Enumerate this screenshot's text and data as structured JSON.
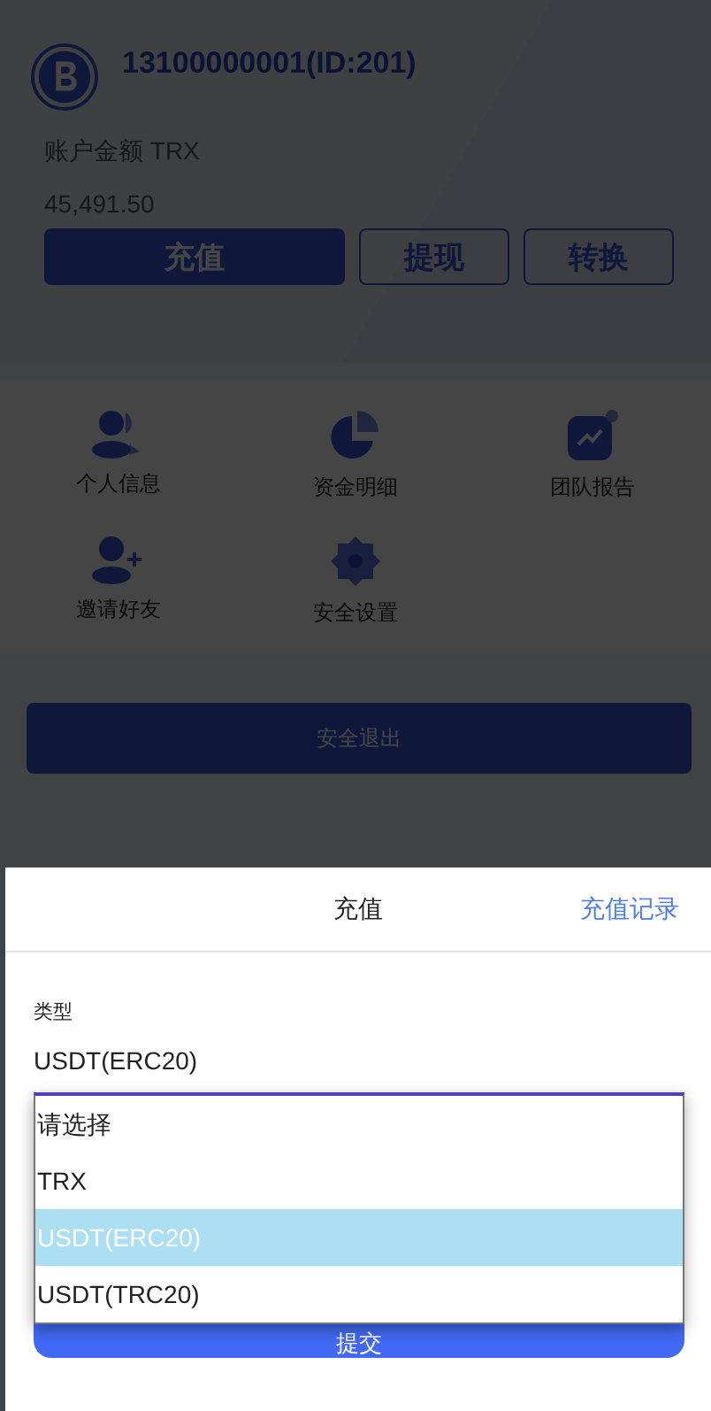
{
  "account": {
    "name": "13100000001(ID:201)",
    "balance_label": "账户金额 TRX",
    "balance": "45,491.50",
    "actions": [
      {
        "label": "充值",
        "kind": "primary"
      },
      {
        "label": "提现",
        "kind": "outline"
      },
      {
        "label": "转换",
        "kind": "outline"
      }
    ]
  },
  "menu": [
    {
      "label": "个人信息",
      "kind": "user"
    },
    {
      "label": "资金明细",
      "kind": "pie"
    },
    {
      "label": "团队报告",
      "kind": "chart"
    },
    {
      "label": "邀请好友",
      "kind": "invite"
    },
    {
      "label": "安全设置",
      "kind": "gear"
    }
  ],
  "logout": "安全退出",
  "sheet": {
    "title": "充值",
    "link": "充值记录",
    "field_label": "类型",
    "field_value": "USDT(ERC20)",
    "options": [
      {
        "label": "请选择",
        "selected": false
      },
      {
        "label": "TRX",
        "selected": false
      },
      {
        "label": "USDT(ERC20)",
        "selected": true
      },
      {
        "label": "USDT(TRC20)",
        "selected": false
      }
    ],
    "submit": "提交"
  }
}
